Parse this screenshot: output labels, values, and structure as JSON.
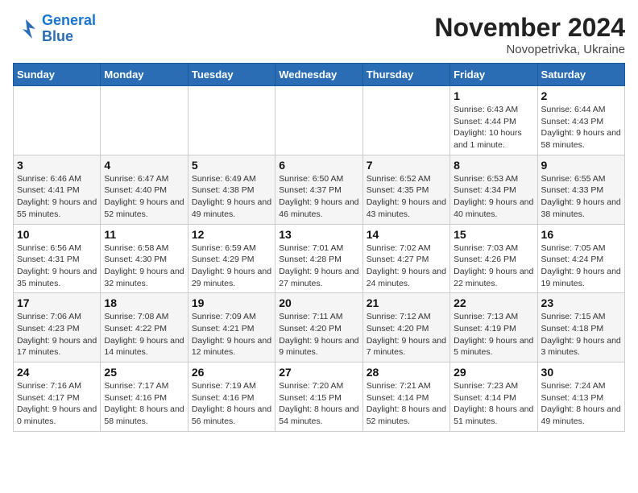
{
  "logo": {
    "line1": "General",
    "line2": "Blue"
  },
  "title": "November 2024",
  "location": "Novopetrivka, Ukraine",
  "weekdays": [
    "Sunday",
    "Monday",
    "Tuesday",
    "Wednesday",
    "Thursday",
    "Friday",
    "Saturday"
  ],
  "weeks": [
    [
      {
        "day": "",
        "info": ""
      },
      {
        "day": "",
        "info": ""
      },
      {
        "day": "",
        "info": ""
      },
      {
        "day": "",
        "info": ""
      },
      {
        "day": "",
        "info": ""
      },
      {
        "day": "1",
        "info": "Sunrise: 6:43 AM\nSunset: 4:44 PM\nDaylight: 10 hours and 1 minute."
      },
      {
        "day": "2",
        "info": "Sunrise: 6:44 AM\nSunset: 4:43 PM\nDaylight: 9 hours and 58 minutes."
      }
    ],
    [
      {
        "day": "3",
        "info": "Sunrise: 6:46 AM\nSunset: 4:41 PM\nDaylight: 9 hours and 55 minutes."
      },
      {
        "day": "4",
        "info": "Sunrise: 6:47 AM\nSunset: 4:40 PM\nDaylight: 9 hours and 52 minutes."
      },
      {
        "day": "5",
        "info": "Sunrise: 6:49 AM\nSunset: 4:38 PM\nDaylight: 9 hours and 49 minutes."
      },
      {
        "day": "6",
        "info": "Sunrise: 6:50 AM\nSunset: 4:37 PM\nDaylight: 9 hours and 46 minutes."
      },
      {
        "day": "7",
        "info": "Sunrise: 6:52 AM\nSunset: 4:35 PM\nDaylight: 9 hours and 43 minutes."
      },
      {
        "day": "8",
        "info": "Sunrise: 6:53 AM\nSunset: 4:34 PM\nDaylight: 9 hours and 40 minutes."
      },
      {
        "day": "9",
        "info": "Sunrise: 6:55 AM\nSunset: 4:33 PM\nDaylight: 9 hours and 38 minutes."
      }
    ],
    [
      {
        "day": "10",
        "info": "Sunrise: 6:56 AM\nSunset: 4:31 PM\nDaylight: 9 hours and 35 minutes."
      },
      {
        "day": "11",
        "info": "Sunrise: 6:58 AM\nSunset: 4:30 PM\nDaylight: 9 hours and 32 minutes."
      },
      {
        "day": "12",
        "info": "Sunrise: 6:59 AM\nSunset: 4:29 PM\nDaylight: 9 hours and 29 minutes."
      },
      {
        "day": "13",
        "info": "Sunrise: 7:01 AM\nSunset: 4:28 PM\nDaylight: 9 hours and 27 minutes."
      },
      {
        "day": "14",
        "info": "Sunrise: 7:02 AM\nSunset: 4:27 PM\nDaylight: 9 hours and 24 minutes."
      },
      {
        "day": "15",
        "info": "Sunrise: 7:03 AM\nSunset: 4:26 PM\nDaylight: 9 hours and 22 minutes."
      },
      {
        "day": "16",
        "info": "Sunrise: 7:05 AM\nSunset: 4:24 PM\nDaylight: 9 hours and 19 minutes."
      }
    ],
    [
      {
        "day": "17",
        "info": "Sunrise: 7:06 AM\nSunset: 4:23 PM\nDaylight: 9 hours and 17 minutes."
      },
      {
        "day": "18",
        "info": "Sunrise: 7:08 AM\nSunset: 4:22 PM\nDaylight: 9 hours and 14 minutes."
      },
      {
        "day": "19",
        "info": "Sunrise: 7:09 AM\nSunset: 4:21 PM\nDaylight: 9 hours and 12 minutes."
      },
      {
        "day": "20",
        "info": "Sunrise: 7:11 AM\nSunset: 4:20 PM\nDaylight: 9 hours and 9 minutes."
      },
      {
        "day": "21",
        "info": "Sunrise: 7:12 AM\nSunset: 4:20 PM\nDaylight: 9 hours and 7 minutes."
      },
      {
        "day": "22",
        "info": "Sunrise: 7:13 AM\nSunset: 4:19 PM\nDaylight: 9 hours and 5 minutes."
      },
      {
        "day": "23",
        "info": "Sunrise: 7:15 AM\nSunset: 4:18 PM\nDaylight: 9 hours and 3 minutes."
      }
    ],
    [
      {
        "day": "24",
        "info": "Sunrise: 7:16 AM\nSunset: 4:17 PM\nDaylight: 9 hours and 0 minutes."
      },
      {
        "day": "25",
        "info": "Sunrise: 7:17 AM\nSunset: 4:16 PM\nDaylight: 8 hours and 58 minutes."
      },
      {
        "day": "26",
        "info": "Sunrise: 7:19 AM\nSunset: 4:16 PM\nDaylight: 8 hours and 56 minutes."
      },
      {
        "day": "27",
        "info": "Sunrise: 7:20 AM\nSunset: 4:15 PM\nDaylight: 8 hours and 54 minutes."
      },
      {
        "day": "28",
        "info": "Sunrise: 7:21 AM\nSunset: 4:14 PM\nDaylight: 8 hours and 52 minutes."
      },
      {
        "day": "29",
        "info": "Sunrise: 7:23 AM\nSunset: 4:14 PM\nDaylight: 8 hours and 51 minutes."
      },
      {
        "day": "30",
        "info": "Sunrise: 7:24 AM\nSunset: 4:13 PM\nDaylight: 8 hours and 49 minutes."
      }
    ]
  ]
}
